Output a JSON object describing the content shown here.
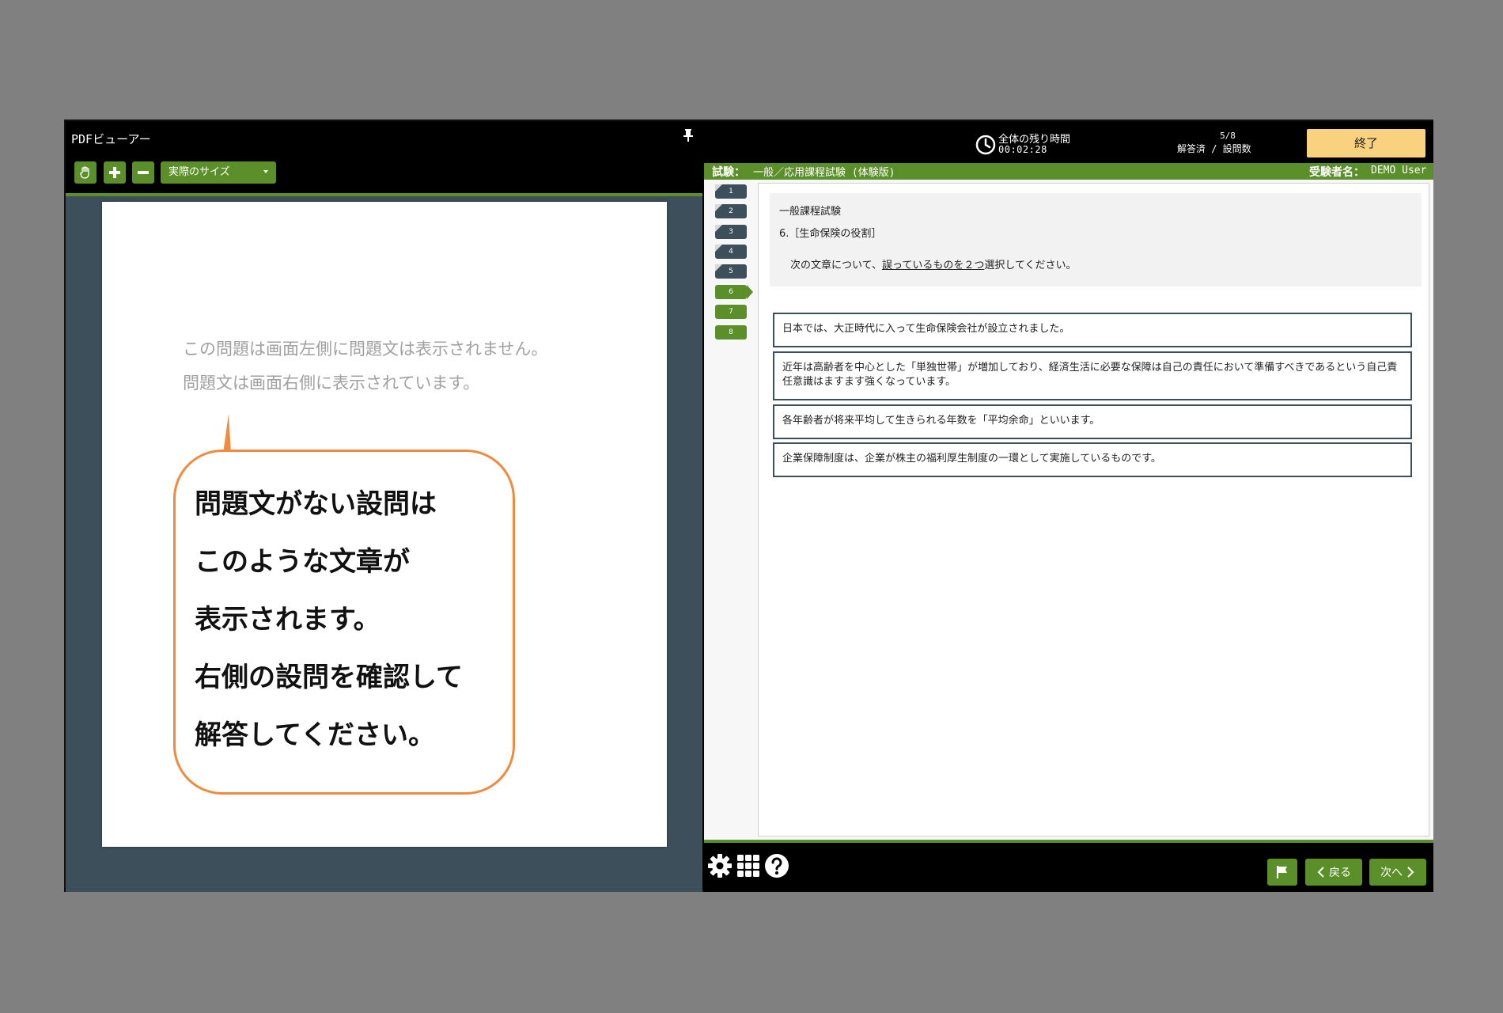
{
  "pdf_viewer": {
    "title": "PDFビューアー",
    "zoom_value": "実際のサイズ",
    "page_lines": [
      "この問題は画面左側に問題文は表示されません。",
      "問題文は画面右側に表示されています。"
    ],
    "callout_lines": [
      "問題文がない設問は",
      "このような文章が",
      "表示されます。",
      "右側の設問を確認して",
      "解答してください。"
    ]
  },
  "header": {
    "timer_label": "全体の残り時間",
    "timer_value": "00:02:28",
    "progress_count": "5/8",
    "progress_label": "解答済 / 設問数",
    "end_button": "終了"
  },
  "exam_bar": {
    "exam_label": "試験：",
    "exam_name": "一般／応用課程試験 (体験版)",
    "examinee_label": "受験者名：",
    "examinee_name": "DEMO User"
  },
  "question_nav": [
    {
      "label": "1",
      "state": "answered"
    },
    {
      "label": "2",
      "state": "answered"
    },
    {
      "label": "3",
      "state": "answered"
    },
    {
      "label": "4",
      "state": "answered"
    },
    {
      "label": "5",
      "state": "answered"
    },
    {
      "label": "6",
      "state": "current"
    },
    {
      "label": "7",
      "state": "unanswered"
    },
    {
      "label": "8",
      "state": "unanswered"
    }
  ],
  "question": {
    "category": "一般課程試験",
    "title": "6.［生命保険の役割］",
    "instruction_before": "次の文章について、",
    "instruction_emphasis": "誤っているものを２つ",
    "instruction_after": "選択してください。",
    "choices": [
      "日本では、大正時代に入って生命保険会社が設立されました。",
      "近年は高齢者を中心とした「単独世帯」が増加しており、経済生活に必要な保障は自己の責任において準備すべきであるという自己責任意識はますます強くなっています。",
      "各年齢者が将来平均して生きられる年数を「平均余命」といいます。",
      "企業保障制度は、企業が株主の福利厚生制度の一環として実施しているものです。"
    ]
  },
  "footer": {
    "back_label": "戻る",
    "next_label": "次へ"
  },
  "colors": {
    "accent": "#5b8f29",
    "end_button": "#f8d27f",
    "callout_border": "#f08a3c",
    "dark_slate": "#3d4f5a"
  }
}
